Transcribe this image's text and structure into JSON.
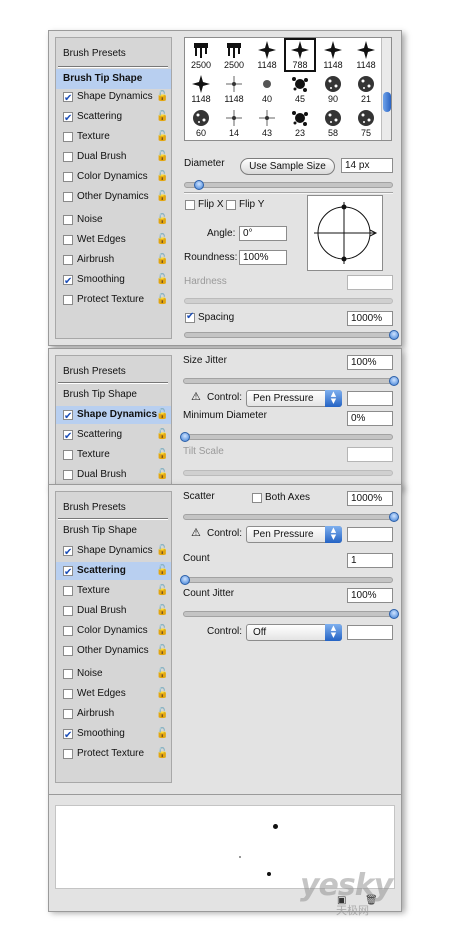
{
  "sidebar_common": {
    "brush_presets": "Brush Presets",
    "brush_tip_shape": "Brush Tip Shape",
    "items": [
      {
        "label": "Shape Dynamics",
        "checked": true
      },
      {
        "label": "Scattering",
        "checked": true
      },
      {
        "label": "Texture",
        "checked": false
      },
      {
        "label": "Dual Brush",
        "checked": false
      },
      {
        "label": "Color Dynamics",
        "checked": false
      },
      {
        "label": "Other Dynamics",
        "checked": false
      },
      {
        "label": "Noise",
        "checked": false
      },
      {
        "label": "Wet Edges",
        "checked": false
      },
      {
        "label": "Airbrush",
        "checked": false
      },
      {
        "label": "Smoothing",
        "checked": true
      },
      {
        "label": "Protect Texture",
        "checked": false
      }
    ]
  },
  "panel1": {
    "brush_grid": {
      "numbers": [
        "2500",
        "2500",
        "1148",
        "788",
        "1148",
        "1148",
        "1148",
        "1148",
        "40",
        "45",
        "90",
        "21",
        "60",
        "14",
        "43",
        "23",
        "58",
        "75"
      ],
      "selected_index": 3
    },
    "diameter_label": "Diameter",
    "use_sample_size": "Use Sample Size",
    "diameter_value": "14 px",
    "flip_x": "Flip X",
    "flip_y": "Flip Y",
    "angle_label": "Angle:",
    "angle_value": "0°",
    "roundness_label": "Roundness:",
    "roundness_value": "100%",
    "hardness_label": "Hardness",
    "spacing_label": "Spacing",
    "spacing_value": "1000%"
  },
  "panel2": {
    "size_jitter_label": "Size Jitter",
    "size_jitter_value": "100%",
    "control_label": "Control:",
    "control_value": "Pen Pressure",
    "min_diameter_label": "Minimum Diameter",
    "min_diameter_value": "0%",
    "tilt_scale_label": "Tilt Scale"
  },
  "panel3": {
    "scatter_label": "Scatter",
    "both_axes_label": "Both Axes",
    "scatter_value": "1000%",
    "control_label": "Control:",
    "control_value": "Pen Pressure",
    "count_label": "Count",
    "count_value": "1",
    "count_jitter_label": "Count Jitter",
    "count_jitter_value": "100%",
    "control2_label": "Control:",
    "control2_value": "Off"
  },
  "watermark": {
    "main": "yesky",
    "sub": "天极网"
  }
}
